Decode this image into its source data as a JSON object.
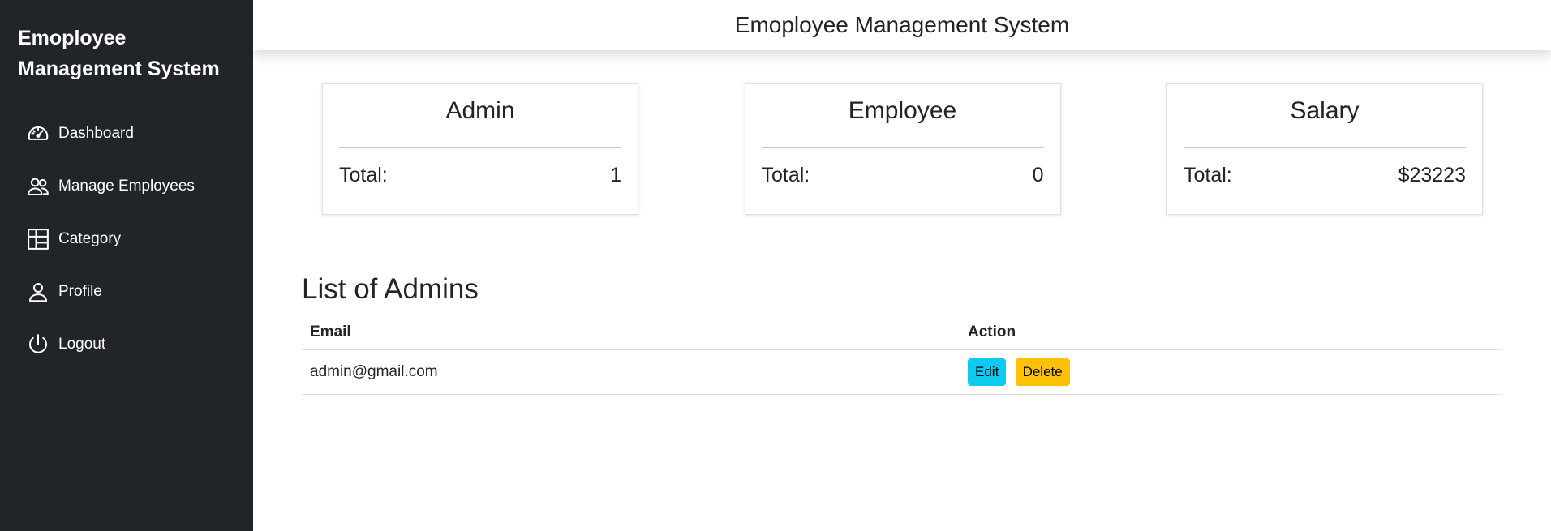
{
  "sidebar": {
    "brand": "Emoployee Management System",
    "items": [
      {
        "label": "Dashboard",
        "icon": "speedometer-icon"
      },
      {
        "label": "Manage Employees",
        "icon": "people-icon"
      },
      {
        "label": "Category",
        "icon": "columns-icon"
      },
      {
        "label": "Profile",
        "icon": "person-icon"
      },
      {
        "label": "Logout",
        "icon": "power-icon"
      }
    ]
  },
  "header": {
    "title": "Emoployee Management System"
  },
  "cards": [
    {
      "title": "Admin",
      "total_label": "Total:",
      "total_value": "1"
    },
    {
      "title": "Employee",
      "total_label": "Total:",
      "total_value": "0"
    },
    {
      "title": "Salary",
      "total_label": "Total:",
      "total_value": "$23223"
    }
  ],
  "admins": {
    "heading": "List of Admins",
    "columns": [
      "Email",
      "Action"
    ],
    "rows": [
      {
        "email": "admin@gmail.com",
        "edit_label": "Edit",
        "delete_label": "Delete"
      }
    ]
  },
  "colors": {
    "sidebar_bg": "#212529",
    "edit_button": "#0dcaf0",
    "delete_button": "#ffc107"
  }
}
